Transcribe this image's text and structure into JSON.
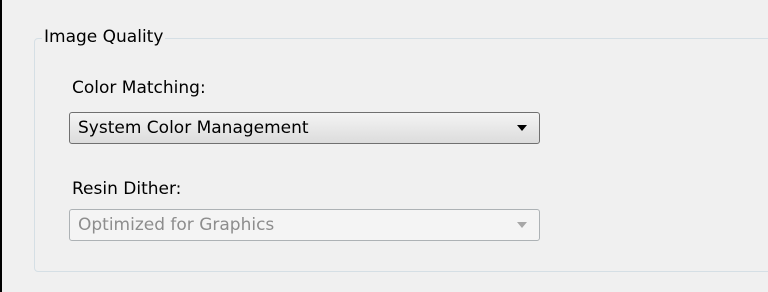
{
  "group": {
    "title": "Image Quality"
  },
  "color_matching": {
    "label": "Color Matching:",
    "value": "System Color Management",
    "arrow_icon": "chevron-down-icon"
  },
  "resin_dither": {
    "label": "Resin Dither:",
    "value": "Optimized for Graphics",
    "disabled": true,
    "arrow_icon": "chevron-down-icon"
  }
}
